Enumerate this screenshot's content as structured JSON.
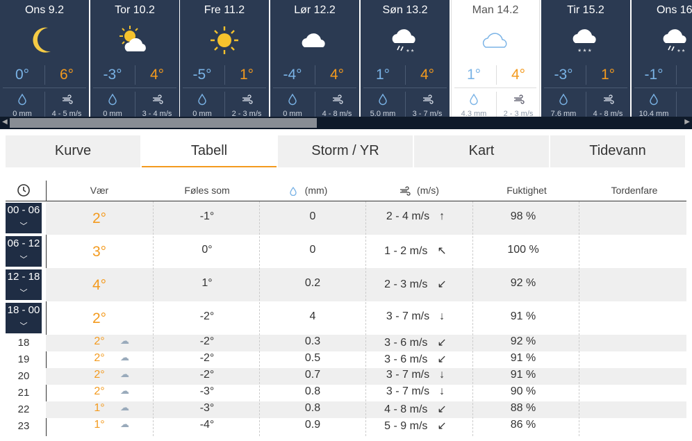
{
  "days": [
    {
      "name": "Ons 9.2",
      "icon": "moon-icon",
      "min": "0°",
      "max": "6°",
      "precip": "0 mm",
      "wind": "4 - 5 m/s"
    },
    {
      "name": "Tor 10.2",
      "icon": "sun-cloud-icon",
      "min": "-3°",
      "max": "4°",
      "precip": "0 mm",
      "wind": "3 - 4 m/s"
    },
    {
      "name": "Fre 11.2",
      "icon": "sun-icon",
      "min": "-5°",
      "max": "1°",
      "precip": "0 mm",
      "wind": "2 - 3 m/s"
    },
    {
      "name": "Lør 12.2",
      "icon": "cloud-icon",
      "min": "-4°",
      "max": "4°",
      "precip": "0 mm",
      "wind": "4 - 8 m/s"
    },
    {
      "name": "Søn 13.2",
      "icon": "sleet-icon",
      "min": "1°",
      "max": "4°",
      "precip": "5.0 mm",
      "wind": "3 - 7 m/s"
    },
    {
      "name": "Man 14.2",
      "icon": "cloud-outline-icon",
      "min": "1°",
      "max": "4°",
      "precip": "4.3 mm",
      "wind": "2 - 3 m/s"
    },
    {
      "name": "Tir 15.2",
      "icon": "snow-icon",
      "min": "-3°",
      "max": "1°",
      "precip": "7.6 mm",
      "wind": "4 - 8 m/s"
    },
    {
      "name": "Ons 16.",
      "icon": "sleet-icon",
      "min": "-1°",
      "max": "",
      "precip": "10.4 mm",
      "wind": ""
    }
  ],
  "tabs": [
    "Kurve",
    "Tabell",
    "Storm / YR",
    "Kart",
    "Tidevann"
  ],
  "headers": {
    "weather": "Vær",
    "feels": "Føles som",
    "precip": "(mm)",
    "wind": "(m/s)",
    "humidity": "Fuktighet",
    "thunder": "Tordenfare"
  },
  "rows": [
    {
      "time": "00 - 06",
      "temp": "2°",
      "feels": "-1°",
      "precip": "0",
      "wind": "2 - 4 m/s",
      "arrow": "↑",
      "hum": "98 %"
    },
    {
      "time": "06 - 12",
      "temp": "3°",
      "feels": "0°",
      "precip": "0",
      "wind": "1 - 2 m/s",
      "arrow": "↖",
      "hum": "100 %"
    },
    {
      "time": "12 - 18",
      "temp": "4°",
      "feels": "1°",
      "precip": "0.2",
      "wind": "2 - 3 m/s",
      "arrow": "↙",
      "hum": "92 %"
    },
    {
      "time": "18 - 00",
      "temp": "2°",
      "feels": "-2°",
      "precip": "4",
      "wind": "3 - 7 m/s",
      "arrow": "↓",
      "hum": "91 %"
    }
  ],
  "hours": [
    {
      "time": "18",
      "temp": "2°",
      "feels": "-2°",
      "precip": "0.3",
      "wind": "3 - 6 m/s",
      "arrow": "↙",
      "hum": "92 %"
    },
    {
      "time": "19",
      "temp": "2°",
      "feels": "-2°",
      "precip": "0.5",
      "wind": "3 - 6 m/s",
      "arrow": "↙",
      "hum": "91 %"
    },
    {
      "time": "20",
      "temp": "2°",
      "feels": "-2°",
      "precip": "0.7",
      "wind": "3 - 7 m/s",
      "arrow": "↓",
      "hum": "91 %"
    },
    {
      "time": "21",
      "temp": "2°",
      "feels": "-3°",
      "precip": "0.8",
      "wind": "3 - 7 m/s",
      "arrow": "↓",
      "hum": "90 %"
    },
    {
      "time": "22",
      "temp": "1°",
      "feels": "-3°",
      "precip": "0.8",
      "wind": "4 - 8 m/s",
      "arrow": "↙",
      "hum": "88 %"
    },
    {
      "time": "23",
      "temp": "1°",
      "feels": "-4°",
      "precip": "0.9",
      "wind": "5 - 9 m/s",
      "arrow": "↙",
      "hum": "86 %"
    }
  ]
}
